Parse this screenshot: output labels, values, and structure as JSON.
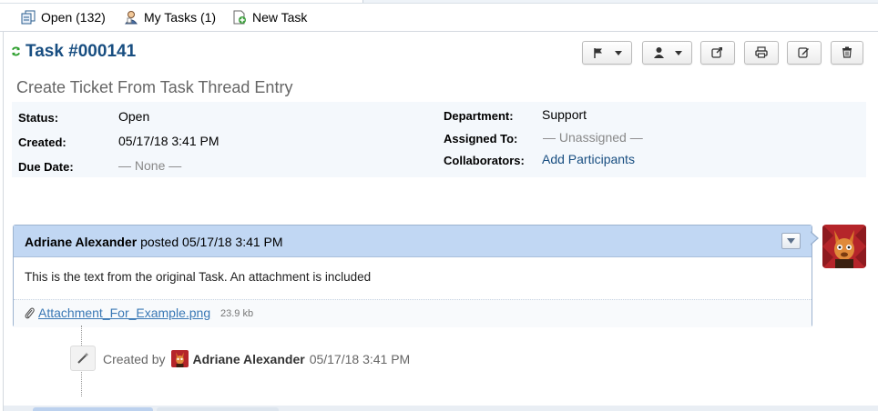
{
  "nav": {
    "open_label": "Open (132)",
    "my_tasks_label": "My Tasks (1)",
    "new_task_label": "New Task"
  },
  "task": {
    "title": "Task #000141",
    "subject": "Create Ticket From Task Thread Entry"
  },
  "info": {
    "status_label": "Status:",
    "status_value": "Open",
    "created_label": "Created:",
    "created_value": "05/17/18 3:41 PM",
    "due_label": "Due Date:",
    "due_value": "— None —",
    "department_label": "Department:",
    "department_value": "Support",
    "assigned_label": "Assigned To:",
    "assigned_value": "— Unassigned —",
    "collab_label": "Collaborators:",
    "collab_value": "Add Participants"
  },
  "thread": {
    "author": "Adriane Alexander",
    "posted_text": "posted",
    "posted_date": "05/17/18 3:41 PM",
    "body": "This is the text from the original Task. An attachment is included",
    "attachment_name": "Attachment_For_Example.png",
    "attachment_size": "23.9 kb"
  },
  "event": {
    "created_by_label": "Created by",
    "author": "Adriane Alexander",
    "date": "05/17/18 3:41 PM"
  },
  "icons": {
    "open": "tasks-icon",
    "my_tasks": "user-icon",
    "new_task": "new-doc-icon",
    "refresh": "refresh-icon",
    "flag": "flag-icon",
    "assign": "user-icon",
    "transfer": "share-icon",
    "print": "print-icon",
    "edit": "edit-icon",
    "delete": "trash-icon",
    "attachment": "paperclip-icon",
    "event": "magic-wand-icon"
  },
  "colors": {
    "title": "#184e81",
    "thread_header": "#c1d7f3",
    "info_bg": "#f4f8fc",
    "link": "#3a78b5",
    "refresh": "#2e9f2e"
  }
}
